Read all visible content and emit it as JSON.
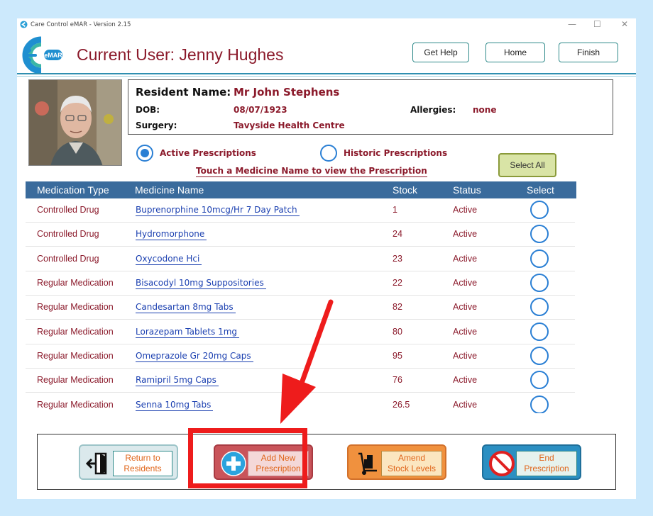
{
  "window": {
    "title": "Care Control eMAR - Version 2.15",
    "controls": {
      "minimize": "—",
      "maximize": "☐",
      "close": "✕"
    }
  },
  "header": {
    "logo_text": "eMAR",
    "current_user": "Current User: Jenny Hughes",
    "buttons": {
      "help": "Get Help",
      "home": "Home",
      "finish": "Finish"
    }
  },
  "resident": {
    "name_label": "Resident Name:",
    "name": "Mr John Stephens",
    "dob_label": "DOB:",
    "dob": "08/07/1923",
    "allergies_label": "Allergies:",
    "allergies": "none",
    "surgery_label": "Surgery:",
    "surgery": "Tavyside Health Centre"
  },
  "filters": {
    "active": "Active Prescriptions",
    "historic": "Historic Prescriptions",
    "selected": "active"
  },
  "hint": "Touch a Medicine Name to view the Prescription",
  "select_all": "Select All",
  "table": {
    "headers": [
      "Medication Type",
      "Medicine Name",
      "Stock",
      "Status",
      "Select"
    ],
    "rows": [
      {
        "type": "Controlled Drug",
        "name": "Buprenorphine  10mcg/Hr 7 Day Patch",
        "stock": "1",
        "status": "Active"
      },
      {
        "type": "Controlled Drug",
        "name": "Hydromorphone",
        "stock": "24",
        "status": "Active"
      },
      {
        "type": "Controlled Drug",
        "name": "Oxycodone Hci",
        "stock": "23",
        "status": "Active"
      },
      {
        "type": "Regular Medication",
        "name": "Bisacodyl 10mg Suppositories",
        "stock": "22",
        "status": "Active"
      },
      {
        "type": "Regular Medication",
        "name": "Candesartan 8mg Tabs",
        "stock": "82",
        "status": "Active"
      },
      {
        "type": "Regular Medication",
        "name": "Lorazepam Tablets 1mg",
        "stock": "80",
        "status": "Active"
      },
      {
        "type": "Regular Medication",
        "name": "Omeprazole Gr 20mg Caps",
        "stock": "95",
        "status": "Active"
      },
      {
        "type": "Regular Medication",
        "name": "Ramipril 5mg Caps",
        "stock": "76",
        "status": "Active"
      },
      {
        "type": "Regular Medication",
        "name": "Senna 10mg Tabs",
        "stock": "26.5",
        "status": "Active"
      }
    ]
  },
  "actions": {
    "return": "Return to\nResidents",
    "add": "Add New\nPrescription",
    "amend": "Amend\nStock Levels",
    "end": "End\nPrescription"
  },
  "colors": {
    "accent_red": "#8b1a2b",
    "header_blue": "#3a6b9c",
    "link_blue": "#1a3fb0",
    "highlight": "#ee1c1c"
  }
}
